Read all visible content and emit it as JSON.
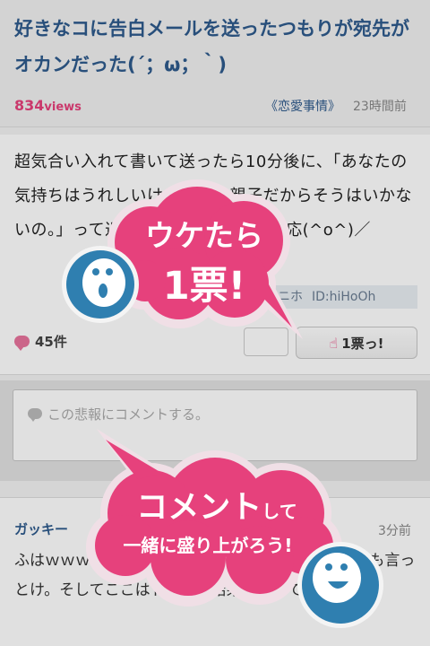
{
  "article": {
    "title": "好きなコに告白メールを送ったつもりが宛先がオカンだった(´；ω；｀)",
    "views_count": "834",
    "views_unit": "views",
    "category": "《恋愛事情》",
    "time_ago": "23時間前",
    "body": "超気合い入れて書いて送ったら10分後に、「あなたの気持ちはうれしいけど私たち親子だからそうはいかないの。」って返ってきた。オカン神対応(^o^)／",
    "author_name": "ニホ",
    "author_id": "ID:hiHoOh",
    "comment_count": "45件",
    "vote_label": "1票っ!"
  },
  "comment_input": {
    "placeholder": "この悲報にコメントする。"
  },
  "first_comment": {
    "user": "ガッキー",
    "time_ago": "3分前",
    "text": "ふはｗｗｗ 親父ちゃんにも言っとけｗｗ父ちゃんにも言っとけ。そしてここはドヤ顔で結果報告がてら里帰り"
  },
  "overlay": {
    "vote_tip_line1": "ウケたら",
    "vote_tip_line2": "1票!",
    "comment_tip_big": "コメント",
    "comment_tip_small": "して",
    "comment_tip_line2": "一緒に盛り上がろう!"
  },
  "colors": {
    "accent_pink": "#e6417c",
    "link_blue": "#2e5a8c",
    "mascot_blue": "#2f7fb0"
  }
}
